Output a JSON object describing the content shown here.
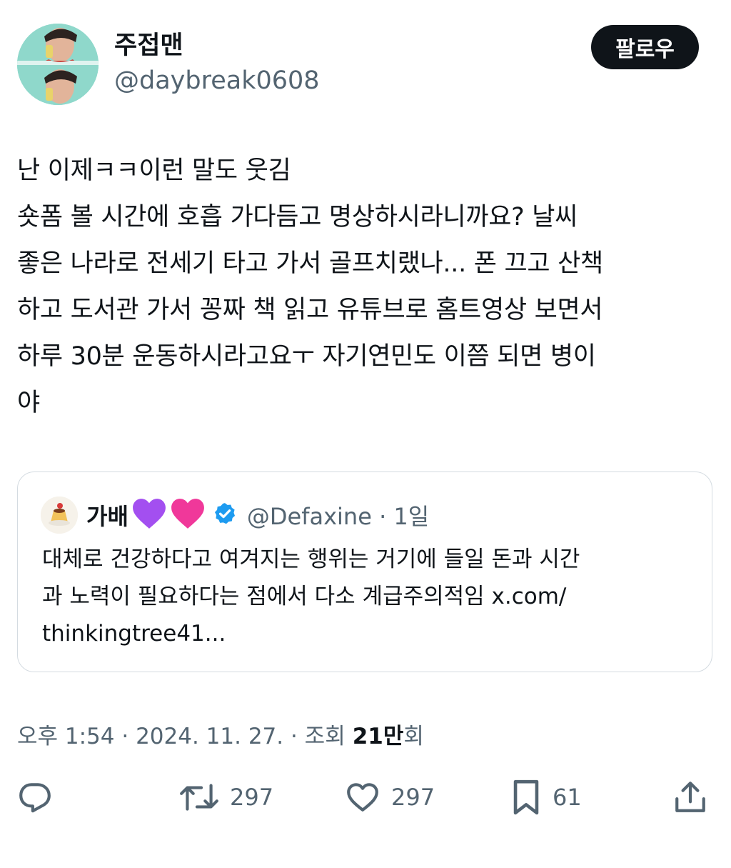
{
  "author": {
    "name": "주접맨",
    "handle": "@daybreak0608",
    "follow_label": "팔로우"
  },
  "tweet": {
    "lines": [
      "난 이제ㅋㅋ이런 말도 웃김",
      "숏폼 볼 시간에 호흡 가다듬고 명상하시라니까요? 날씨",
      "좋은 나라로 전세기 타고 가서 골프치랬나... 폰 끄고 산책",
      "하고 도서관 가서 꽁짜 책 읽고 유튜브로 홈트영상 보면서",
      "하루 30분 운동하시라고요ㅜ 자기연민도 이쯤 되면 병이",
      "야"
    ]
  },
  "quote": {
    "name": "가배",
    "emojis": [
      "purple-heart",
      "pink-heart"
    ],
    "handle_time": "@Defaxine · 1일",
    "lines": [
      "대체로 건강하다고 여겨지는 행위는 거기에 들일 돈과 시간",
      "과 노력이 필요하다는 점에서 다소 계급주의적임 x.com/",
      "thinkingtree41..."
    ]
  },
  "meta": {
    "timestamp": "오후 1:54 · 2024. 11. 27. · 조회",
    "views": "21만",
    "views_suffix": "회"
  },
  "actions": {
    "reply_icon": "reply-icon",
    "retweet_icon": "retweet-icon",
    "retweet_count": "297",
    "like_icon": "heart-icon",
    "like_count": "297",
    "bookmark_icon": "bookmark-icon",
    "bookmark_count": "61",
    "share_icon": "share-icon"
  },
  "colors": {
    "text": "#0f1419",
    "secondary": "#536471",
    "border": "#d4dbe1",
    "verified": "#1d9bf0"
  }
}
